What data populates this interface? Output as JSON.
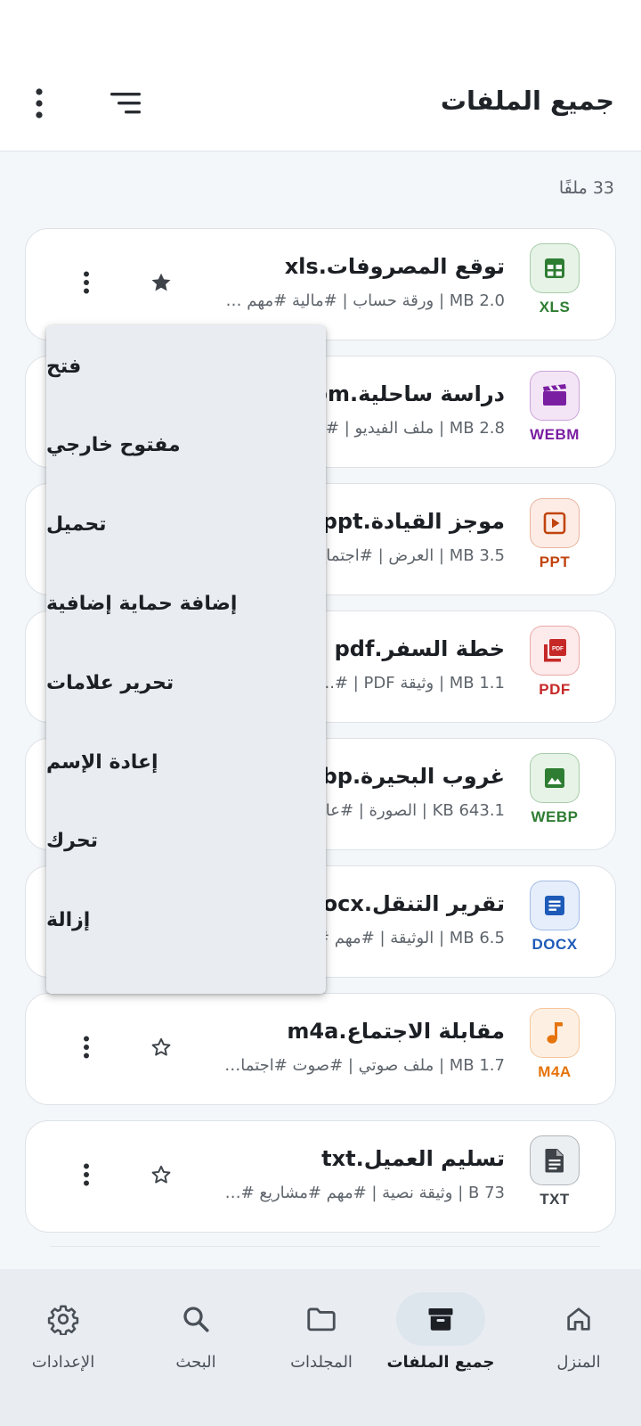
{
  "header": {
    "title": "جميع الملفات"
  },
  "file_count": "33 ملفًا",
  "files": [
    {
      "type_label": "XLS",
      "name": "توقع المصروفات.xls",
      "meta": "2.0 MB | ورقة حساب | #مالية  #مهم  #...",
      "starred": true,
      "color": "#2e7d32",
      "bg": "#e6f3e6",
      "icon": "table-icon"
    },
    {
      "type_label": "WEBM",
      "name": "دراسة ساحلية.webm",
      "meta": "2.8 MB | ملف الفيديو | #أ...",
      "starred": false,
      "color": "#7b1fa2",
      "bg": "#f3e5f5",
      "icon": "video-clip-icon"
    },
    {
      "type_label": "PPT",
      "name": "موجز القيادة.ppt",
      "meta": "3.5 MB | العرض | #اجتماع...",
      "starred": false,
      "color": "#c1440e",
      "bg": "#fdece6",
      "icon": "slideshow-icon"
    },
    {
      "type_label": "PDF",
      "name": "خطة السفر.pdf",
      "meta": "1.1 MB | وثيقة PDF | #...",
      "starred": false,
      "color": "#c62828",
      "bg": "#fdeaea",
      "icon": "pdf-icon"
    },
    {
      "type_label": "WEBP",
      "name": "غروب البحيرة.webp",
      "meta": "643.1 KB | الصورة | #عائ...",
      "starred": false,
      "color": "#2e7d32",
      "bg": "#e6f3e6",
      "icon": "image-icon"
    },
    {
      "type_label": "DOCX",
      "name": "تقرير التنقل.docx",
      "meta": "6.5 MB | الوثيقة | #مهم  #...",
      "starred": false,
      "color": "#1e5bb8",
      "bg": "#e6eefb",
      "icon": "document-icon"
    },
    {
      "type_label": "M4A",
      "name": "مقابلة الاجتماع.m4a",
      "meta": "1.7 MB | ملف صوتي | #صوت  #اجتماعا...",
      "starred": false,
      "color": "#e6730b",
      "bg": "#fdf0e3",
      "icon": "music-note-icon"
    },
    {
      "type_label": "TXT",
      "name": "تسليم العميل.txt",
      "meta": "73 B | وثيقة نصية | #مهم  #مشاريع  #عمل",
      "starred": false,
      "color": "#3d4349",
      "bg": "#eceff2",
      "icon": "text-file-icon"
    }
  ],
  "context_menu": {
    "items": [
      "فتح",
      "مفتوح خارجي",
      "تحميل",
      "إضافة حماية إضافية",
      "تحرير علامات",
      "إعادة الإسم",
      "تحرك",
      "إزالة"
    ]
  },
  "bottom_nav": {
    "items": [
      {
        "label": "المنزل",
        "icon": "home-icon",
        "active": false
      },
      {
        "label": "جميع الملفات",
        "icon": "archive-icon",
        "active": true
      },
      {
        "label": "المجلدات",
        "icon": "folder-icon",
        "active": false
      },
      {
        "label": "البحث",
        "icon": "search-icon",
        "active": false
      },
      {
        "label": "الإعدادات",
        "icon": "gear-icon",
        "active": false
      }
    ]
  },
  "colors": {
    "accent": "#1c1f24",
    "background": "#f4f7fa",
    "star": "#3d4349"
  }
}
